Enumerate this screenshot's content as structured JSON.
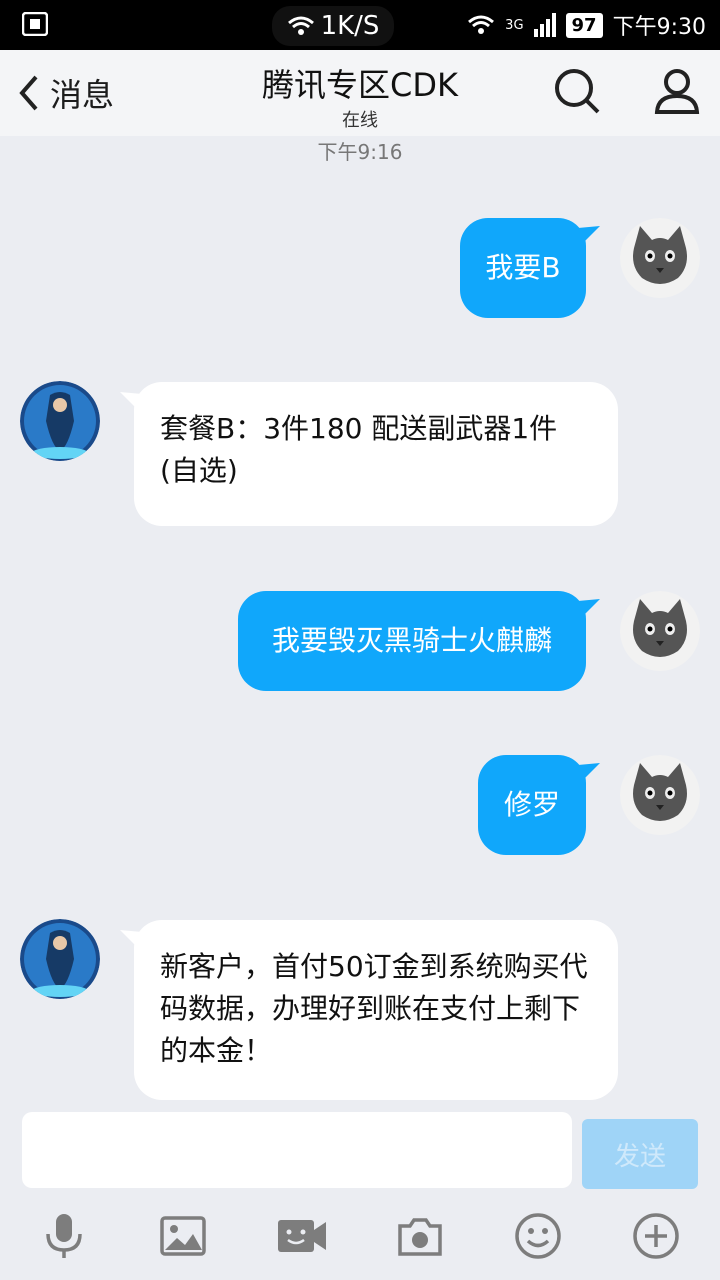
{
  "status": {
    "speed": "1K/S",
    "network": "3G",
    "battery": "97",
    "time": "下午9:30"
  },
  "header": {
    "back_label": "消息",
    "title": "腾讯专区CDK",
    "subtitle": "在线"
  },
  "timestamp": "下午9:16",
  "messages": [
    {
      "from": "me",
      "text": "我要B"
    },
    {
      "from": "them",
      "text": "套餐B：3件180  配送副武器1件(自选)"
    },
    {
      "from": "me",
      "text": "我要毁灭黑骑士火麒麟"
    },
    {
      "from": "me",
      "text": "修罗"
    },
    {
      "from": "them",
      "text": "新客户，首付50订金到系统购买代码数据，办理好到账在支付上剩下的本金！"
    }
  ],
  "composer": {
    "send_label": "发送",
    "input_value": ""
  },
  "colors": {
    "my_bubble": "#10a7fb",
    "their_bubble": "#ffffff",
    "background": "#ebedf2"
  },
  "icons": [
    "mic-icon",
    "image-icon",
    "video-call-icon",
    "camera-icon",
    "emoji-icon",
    "plus-icon"
  ]
}
